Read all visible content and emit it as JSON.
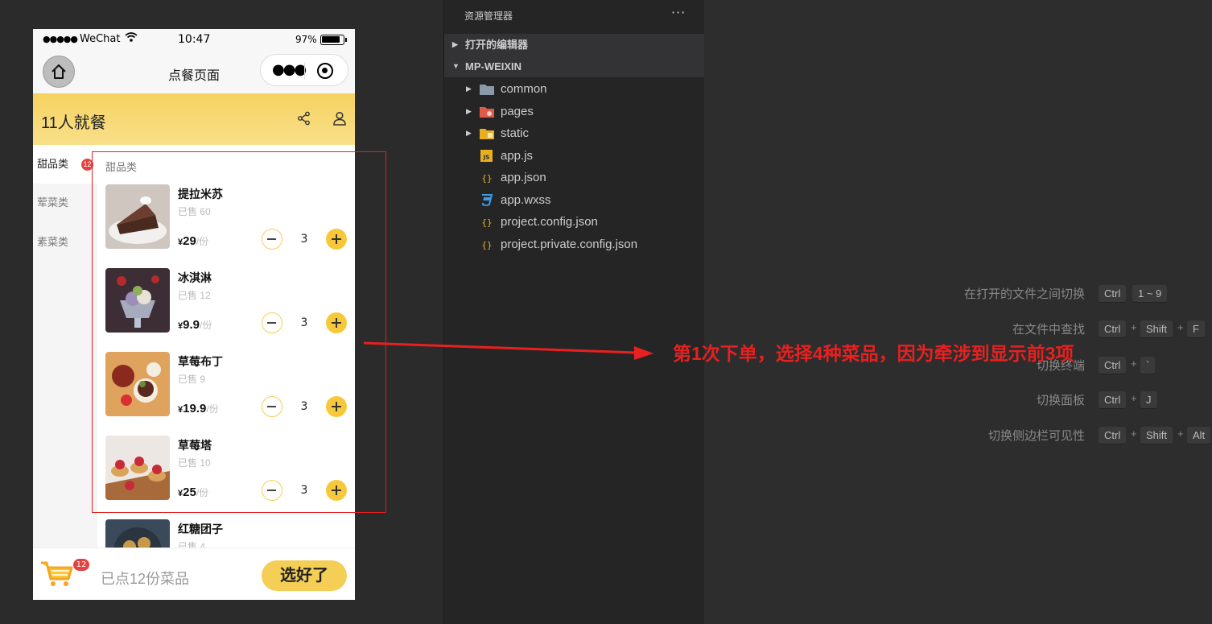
{
  "phone": {
    "status_bar": {
      "signal": "●●●●●",
      "carrier": "WeChat",
      "time": "10:47",
      "battery": "97%",
      "battery_level": 0.97
    },
    "nav": {
      "title": "点餐页面"
    },
    "header": {
      "diners": "11人就餐"
    },
    "categories": [
      {
        "label": "甜品类",
        "badge": "12",
        "active": true
      },
      {
        "label": "荤菜类",
        "badge": "",
        "active": false
      },
      {
        "label": "素菜类",
        "badge": "",
        "active": false
      }
    ],
    "section_title": "甜品类",
    "dishes": [
      {
        "name": "提拉米苏",
        "sold": "已售 60",
        "currency": "¥",
        "price": "29",
        "unit": "/份",
        "qty": "3",
        "img_color": "#6b3e2e"
      },
      {
        "name": "冰淇淋",
        "sold": "已售 12",
        "currency": "¥",
        "price": "9.9",
        "unit": "/份",
        "qty": "3",
        "img_color": "#8a7a9a"
      },
      {
        "name": "草莓布丁",
        "sold": "已售 9",
        "currency": "¥",
        "price": "19.9",
        "unit": "/份",
        "qty": "3",
        "img_color": "#d9884a"
      },
      {
        "name": "草莓塔",
        "sold": "已售 10",
        "currency": "¥",
        "price": "25",
        "unit": "/份",
        "qty": "3",
        "img_color": "#c94040"
      },
      {
        "name": "红糖团子",
        "sold": "已售 4",
        "currency": "",
        "price": "",
        "unit": "",
        "qty": "",
        "img_color": "#3a4a5a"
      }
    ],
    "cart": {
      "badge": "12",
      "summary": "已点12份菜品",
      "checkout": "选好了"
    }
  },
  "explorer": {
    "title": "资源管理器",
    "more": "···",
    "sections": [
      {
        "label": "打开的编辑器",
        "caret": "▶"
      },
      {
        "label": "MP-WEIXIN",
        "caret": "▼"
      }
    ],
    "tree": [
      {
        "label": "common",
        "icon": "folder-icon",
        "caret": "▶"
      },
      {
        "label": "pages",
        "icon": "pages-folder-icon",
        "caret": "▶"
      },
      {
        "label": "static",
        "icon": "static-folder-icon",
        "caret": "▶"
      },
      {
        "label": "app.js",
        "icon": "js-file-icon",
        "caret": ""
      },
      {
        "label": "app.json",
        "icon": "json-file-icon",
        "caret": ""
      },
      {
        "label": "app.wxss",
        "icon": "css-file-icon",
        "caret": ""
      },
      {
        "label": "project.config.json",
        "icon": "json-file-icon",
        "caret": ""
      },
      {
        "label": "project.private.config.json",
        "icon": "json-file-icon",
        "caret": ""
      }
    ]
  },
  "shortcuts": [
    {
      "label": "在打开的文件之间切换",
      "keys": [
        "Ctrl",
        "1 ~ 9"
      ]
    },
    {
      "label": "在文件中查找",
      "keys": [
        "Ctrl",
        "Shift",
        "F"
      ]
    },
    {
      "label": "切换终端",
      "keys": [
        "Ctrl",
        "`"
      ]
    },
    {
      "label": "切换面板",
      "keys": [
        "Ctrl",
        "J"
      ]
    },
    {
      "label": "切换侧边栏可见性",
      "keys": [
        "Ctrl",
        "Shift",
        "Alt"
      ]
    }
  ],
  "annotation": {
    "text": "第1次下单，选择4种菜品，因为牵涉到显示前3项",
    "color": "#e82020"
  }
}
